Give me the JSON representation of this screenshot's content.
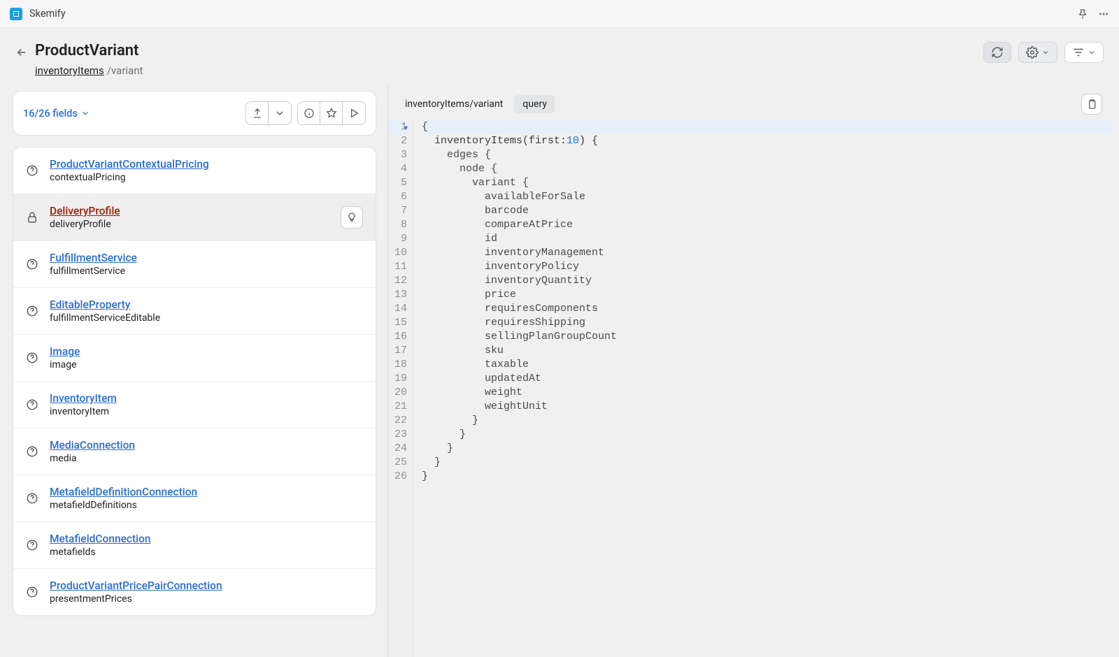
{
  "app": {
    "title": "Skemify"
  },
  "header": {
    "page_title": "ProductVariant",
    "breadcrumb_root": "inventoryItems",
    "breadcrumb_tail": "/variant"
  },
  "fields_card": {
    "count_label": "16/26 fields"
  },
  "field_list": [
    {
      "type": "ProductVariantContextualPricing",
      "name": "contextualPricing",
      "icon": "help",
      "selected": false
    },
    {
      "type": "DeliveryProfile",
      "name": "deliveryProfile",
      "icon": "lock",
      "selected": true
    },
    {
      "type": "FulfillmentService",
      "name": "fulfillmentService",
      "icon": "help",
      "selected": false
    },
    {
      "type": "EditableProperty",
      "name": "fulfillmentServiceEditable",
      "icon": "help",
      "selected": false
    },
    {
      "type": "Image",
      "name": "image",
      "icon": "help",
      "selected": false
    },
    {
      "type": "InventoryItem",
      "name": "inventoryItem",
      "icon": "help",
      "selected": false
    },
    {
      "type": "MediaConnection",
      "name": "media",
      "icon": "help",
      "selected": false
    },
    {
      "type": "MetafieldDefinitionConnection",
      "name": "metafieldDefinitions",
      "icon": "help",
      "selected": false
    },
    {
      "type": "MetafieldConnection",
      "name": "metafields",
      "icon": "help",
      "selected": false
    },
    {
      "type": "ProductVariantPricePairConnection",
      "name": "presentmentPrices",
      "icon": "help",
      "selected": false
    }
  ],
  "editor": {
    "breadcrumb": "inventoryItems/variant",
    "tab_label": "query",
    "lines": [
      {
        "n": 1,
        "text": "{",
        "first": true,
        "fold": true
      },
      {
        "n": 2,
        "text": "  inventoryItems(first:",
        "num": "10",
        "tail": ") {"
      },
      {
        "n": 3,
        "text": "    edges {"
      },
      {
        "n": 4,
        "text": "      node {"
      },
      {
        "n": 5,
        "text": "        variant {"
      },
      {
        "n": 6,
        "text": "          availableForSale"
      },
      {
        "n": 7,
        "text": "          barcode"
      },
      {
        "n": 8,
        "text": "          compareAtPrice"
      },
      {
        "n": 9,
        "text": "          id"
      },
      {
        "n": 10,
        "text": "          inventoryManagement"
      },
      {
        "n": 11,
        "text": "          inventoryPolicy"
      },
      {
        "n": 12,
        "text": "          inventoryQuantity"
      },
      {
        "n": 13,
        "text": "          price"
      },
      {
        "n": 14,
        "text": "          requiresComponents"
      },
      {
        "n": 15,
        "text": "          requiresShipping"
      },
      {
        "n": 16,
        "text": "          sellingPlanGroupCount"
      },
      {
        "n": 17,
        "text": "          sku"
      },
      {
        "n": 18,
        "text": "          taxable"
      },
      {
        "n": 19,
        "text": "          updatedAt"
      },
      {
        "n": 20,
        "text": "          weight"
      },
      {
        "n": 21,
        "text": "          weightUnit"
      },
      {
        "n": 22,
        "text": "        }"
      },
      {
        "n": 23,
        "text": "      }"
      },
      {
        "n": 24,
        "text": "    }"
      },
      {
        "n": 25,
        "text": "  }"
      },
      {
        "n": 26,
        "text": "}"
      }
    ]
  }
}
